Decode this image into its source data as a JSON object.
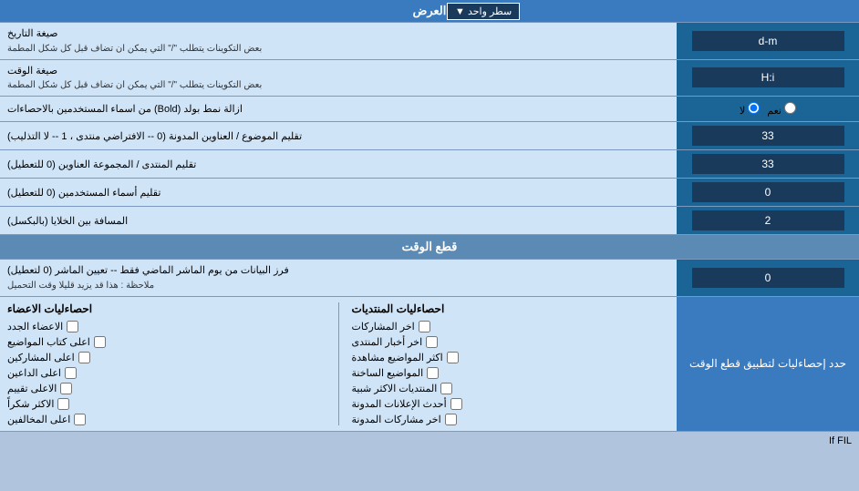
{
  "header": {
    "title": "العرض",
    "dropdown_label": "سطر واحد"
  },
  "rows": [
    {
      "id": "date-format",
      "label_right": "صيغة التاريخ",
      "sublabel_right": "بعض التكوينات يتطلب \"/\" التي يمكن ان تضاف قبل كل شكل المطمة",
      "input_value": "d-m"
    },
    {
      "id": "time-format",
      "label_right": "صيغة الوقت",
      "sublabel_right": "بعض التكوينات يتطلب \"/\" التي يمكن ان تضاف قبل كل شكل المطمة",
      "input_value": "H:i"
    },
    {
      "id": "bold-remove",
      "label_right": "ازالة نمط بولد (Bold) من اسماء المستخدمين بالاحصاءات",
      "radio_yes": "نعم",
      "radio_no": "لا",
      "radio_selected": "no"
    },
    {
      "id": "title-order",
      "label_right": "تقليم الموضوع / العناوين المدونة (0 -- الافتراضي منتدى ، 1 -- لا التذليب)",
      "input_value": "33"
    },
    {
      "id": "forum-trim",
      "label_right": "تقليم المنتدى / المجموعة العناوين (0 للتعطيل)",
      "input_value": "33"
    },
    {
      "id": "user-trim",
      "label_right": "تقليم أسماء المستخدمين (0 للتعطيل)",
      "input_value": "0"
    },
    {
      "id": "cell-spacing",
      "label_right": "المسافة بين الخلايا (بالبكسل)",
      "input_value": "2"
    }
  ],
  "time_cut_section": {
    "title": "قطع الوقت",
    "row": {
      "label_right_main": "فرز البيانات من يوم الماشر الماضي فقط -- تعيين الماشر (0 لتعطيل)",
      "label_right_sub": "ملاحظة : هذا قد يزيد قليلا وقت التحميل",
      "input_value": "0"
    },
    "apply_label": "حدد إحصاءليات لتطبيق قطع الوقت"
  },
  "checkboxes": {
    "col1_header": "احصاءليات المنتديات",
    "col1_items": [
      "اخر المشاركات",
      "اخر أخبار المنتدى",
      "اكثر المواضيع مشاهدة",
      "المواضيع الساخنة",
      "المنتديات الاكثر شبية",
      "أحدث الإعلانات المدونة",
      "اخر مشاركات المدونة"
    ],
    "col2_header": "احصاءليات الاعضاء",
    "col2_items": [
      "الاعضاء الجدد",
      "اعلى كتاب المواضيع",
      "اعلى المشاركين",
      "اعلى الداعين",
      "الاعلى تقييم",
      "الاكثر شكراً",
      "اعلى المخالفين"
    ]
  },
  "if_fil_text": "If FIL"
}
